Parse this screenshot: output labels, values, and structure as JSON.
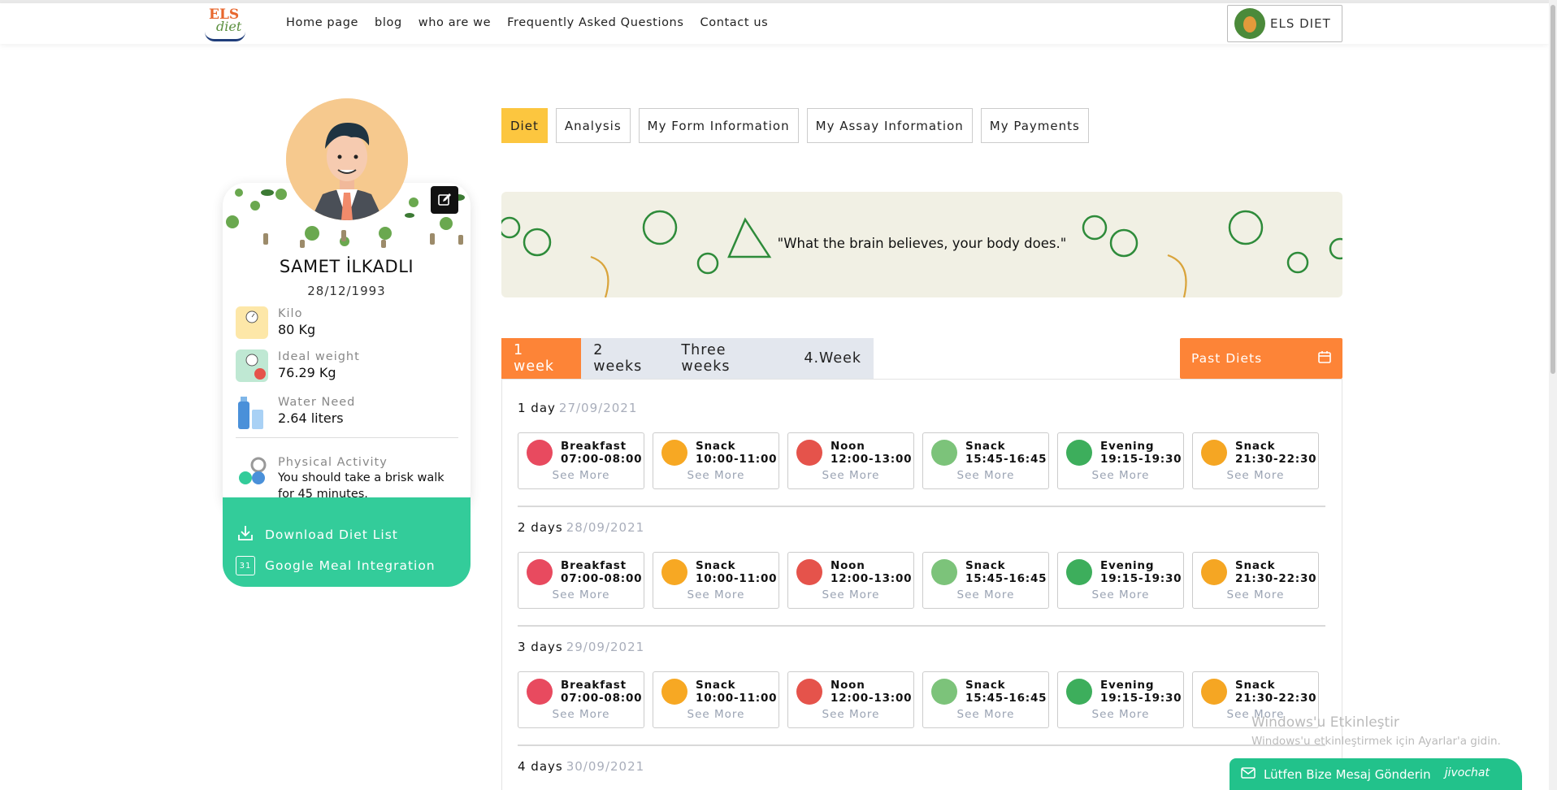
{
  "nav": {
    "logo_text": "ELS",
    "logo_sub": "diet",
    "items": [
      "Home page",
      "blog",
      "who are we",
      "Frequently Asked Questions",
      "Contact us"
    ],
    "user_button": "ELS DIET"
  },
  "profile": {
    "name": "SAMET İLKADLI",
    "birthdate": "28/12/1993",
    "stats": [
      {
        "label": "Kilo",
        "value": "80 Kg",
        "icon": "scale-icon"
      },
      {
        "label": "Ideal weight",
        "value": "76.29 Kg",
        "icon": "ideal-weight-icon"
      },
      {
        "label": "Water Need",
        "value": "2.64 liters",
        "icon": "water-bottle-icon"
      },
      {
        "label": "Physical Activity",
        "value": "You should take a brisk walk for 45 minutes.",
        "icon": "dumbbell-icon"
      }
    ],
    "actions": [
      {
        "label": "Download Diet List",
        "icon": "download-icon"
      },
      {
        "label": "Google Meal Integration",
        "icon": "calendar-icon",
        "icon_text": "31"
      }
    ]
  },
  "tabs": [
    "Diet",
    "Analysis",
    "My Form Information",
    "My Assay Information",
    "My Payments"
  ],
  "active_tab": "Diet",
  "banner": {
    "quote": "\"What the brain believes, your body does.\""
  },
  "weeks": [
    "1 week",
    "2 weeks",
    "Three weeks",
    "4.Week"
  ],
  "active_week": "1 week",
  "past_diets": "Past Diets",
  "see_more": "See More",
  "days": [
    {
      "label": "1 day",
      "date": "27/09/2021"
    },
    {
      "label": "2 days",
      "date": "28/09/2021"
    },
    {
      "label": "3 days",
      "date": "29/09/2021"
    },
    {
      "label": "4 days",
      "date": "30/09/2021"
    }
  ],
  "meals": [
    {
      "name": "Breakfast",
      "time": "07:00-08:00",
      "color": "#e84a5f",
      "icon": "breakfast-icon"
    },
    {
      "name": "Snack",
      "time": "10:00-11:00",
      "color": "#f7a823",
      "icon": "sunrise-icon"
    },
    {
      "name": "Noon",
      "time": "12:00-13:00",
      "color": "#e5534b",
      "icon": "lunch-icon"
    },
    {
      "name": "Snack",
      "time": "15:45-16:45",
      "color": "#7cc37a",
      "icon": "afternoon-icon"
    },
    {
      "name": "Evening",
      "time": "19:15-19:30",
      "color": "#3dae5c",
      "icon": "dinner-icon"
    },
    {
      "name": "Snack",
      "time": "21:30-22:30",
      "color": "#f5a623",
      "icon": "moon-icon"
    }
  ],
  "watermark": {
    "line1": "Windows'u Etkinleştir",
    "line2": "Windows'u etkinleştirmek için Ayarlar'a gidin."
  },
  "chat": {
    "label": "Lütfen Bize Mesaj Gönderin",
    "brand": "jivochat"
  }
}
